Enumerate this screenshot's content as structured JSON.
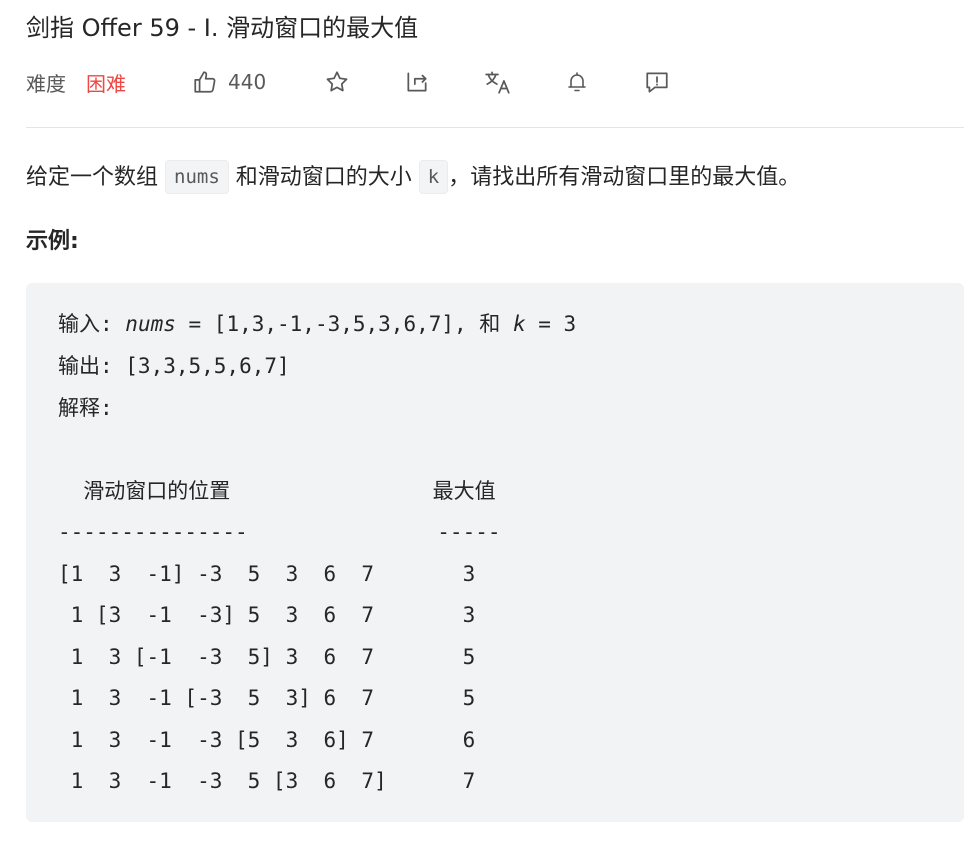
{
  "problem": {
    "title": "剑指 Offer 59 - I. 滑动窗口的最大值",
    "difficulty_label": "难度",
    "difficulty": "困难",
    "likes": "440"
  },
  "description": {
    "part1": "给定一个数组 ",
    "code1": "nums",
    "part2": " 和滑动窗口的大小 ",
    "code2": "k",
    "part3": "，请找出所有滑动窗口里的最大值。"
  },
  "example": {
    "heading": "示例:",
    "input_label": "输入: ",
    "input_var1": "nums",
    "input_mid": " = [1,3,-1,-3,5,3,6,7], 和 ",
    "input_var2": "k",
    "input_end": " = 3",
    "output_line": "输出: [3,3,5,5,6,7]",
    "explain_line": "解释:",
    "table_header": "  滑动窗口的位置                最大值",
    "table_rule": "---------------               -----",
    "rows": [
      "[1  3  -1] -3  5  3  6  7       3",
      " 1 [3  -1  -3] 5  3  6  7       3",
      " 1  3 [-1  -3  5] 3  6  7       5",
      " 1  3  -1 [-3  5  3] 6  7       5",
      " 1  3  -1  -3 [5  3  6] 7       6",
      " 1  3  -1  -3  5 [3  6  7]      7"
    ]
  },
  "icons": {
    "like": "thumbs-up-icon",
    "favorite": "star-icon",
    "share": "share-icon",
    "translate": "translate-icon",
    "notify": "bell-icon",
    "feedback": "feedback-icon"
  },
  "colors": {
    "difficulty_hard": "#ef4743",
    "code_bg": "#f2f3f5"
  }
}
